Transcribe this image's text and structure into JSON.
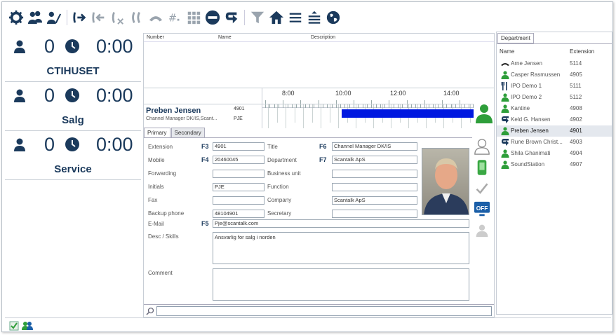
{
  "toolbar": {
    "icons": [
      "settings-icon",
      "users-icon",
      "user-edit-icon",
      "transfer-icon",
      "transfer-back-icon",
      "transfer-cancel-icon",
      "conference-icon",
      "hangup-icon",
      "dtmf-icon",
      "keypad-icon",
      "do-not-disturb-icon",
      "redirect-icon",
      "filter-icon",
      "home-icon",
      "list-icon",
      "sort-icon",
      "globe-icon"
    ]
  },
  "queues": [
    {
      "name": "CTIHUSET",
      "count": "0",
      "time": "0:00"
    },
    {
      "name": "Salg",
      "count": "0",
      "time": "0:00"
    },
    {
      "name": "Service",
      "count": "0",
      "time": "0:00"
    }
  ],
  "grid": {
    "col_number": "Number",
    "col_name": "Name",
    "col_description": "Description"
  },
  "timeline": {
    "hours": [
      "8:00",
      "10:00",
      "12:00",
      "14:00"
    ],
    "person_name": "Preben Jensen",
    "person_title": "Channel Manager DK/IS,Scant...",
    "extension": "4901",
    "initials": "PJE",
    "busy_bar_color": "#0018e0"
  },
  "tabs": {
    "primary": "Primary",
    "secondary": "Secondary"
  },
  "form": {
    "extension_label": "Extension",
    "extension_key": "F3",
    "extension_value": "4901",
    "title_label": "Title",
    "title_key": "F6",
    "title_value": "Channel Manager DK/IS",
    "mobile_label": "Mobile",
    "mobile_key": "F4",
    "mobile_value": "20460045",
    "department_label": "Department",
    "department_key": "F7",
    "department_value": "Scantalk ApS",
    "forwarding_label": "Forwarding",
    "forwarding_value": "",
    "business_unit_label": "Business unit",
    "business_unit_value": "",
    "initials_label": "Initials",
    "initials_value": "PJE",
    "function_label": "Function",
    "function_value": "",
    "fax_label": "Fax",
    "fax_value": "",
    "company_label": "Company",
    "company_value": "Scantalk ApS",
    "backup_label": "Backup phone",
    "backup_value": "48104901",
    "secretary_label": "Secretary",
    "secretary_value": "",
    "email_label": "E-Mail",
    "email_key": "F5",
    "email_value": "Pje@scantalk.com",
    "desc_label": "Desc / Skills",
    "desc_value": "Ansvarlig for salg i norden",
    "comment_label": "Comment",
    "comment_value": ""
  },
  "side_buttons": {
    "off_label": "OFF"
  },
  "department": {
    "tab": "Department",
    "col_name": "Name",
    "col_extension": "Extension",
    "rows": [
      {
        "name": "Arne Jensen",
        "ext": "5114",
        "status": "on-call",
        "icon": "handset-icon"
      },
      {
        "name": "Casper Rasmussen",
        "ext": "4905",
        "status": "available",
        "icon": "user-green-icon"
      },
      {
        "name": "IPO Demo 1",
        "ext": "5111",
        "status": "lunch",
        "icon": "cutlery-icon"
      },
      {
        "name": "IPO Demo 2",
        "ext": "5112",
        "status": "available",
        "icon": "user-green-icon"
      },
      {
        "name": "Kantine",
        "ext": "4908",
        "status": "available",
        "icon": "user-green-icon"
      },
      {
        "name": "Keld G. Hansen",
        "ext": "4902",
        "status": "redirect",
        "icon": "redirect-icon"
      },
      {
        "name": "Preben Jensen",
        "ext": "4901",
        "status": "available",
        "icon": "user-green-icon"
      },
      {
        "name": "Rune Brown Christ...",
        "ext": "4903",
        "status": "redirect",
        "icon": "redirect-icon"
      },
      {
        "name": "Shila Ghanimati",
        "ext": "4904",
        "status": "available",
        "icon": "user-green-icon"
      },
      {
        "name": "SoundStation",
        "ext": "4907",
        "status": "available",
        "icon": "user-green-icon"
      }
    ],
    "selected_index": 6
  },
  "colors": {
    "navy": "#1b3a5c",
    "green": "#2e9e3a",
    "busy": "#0018e0"
  }
}
